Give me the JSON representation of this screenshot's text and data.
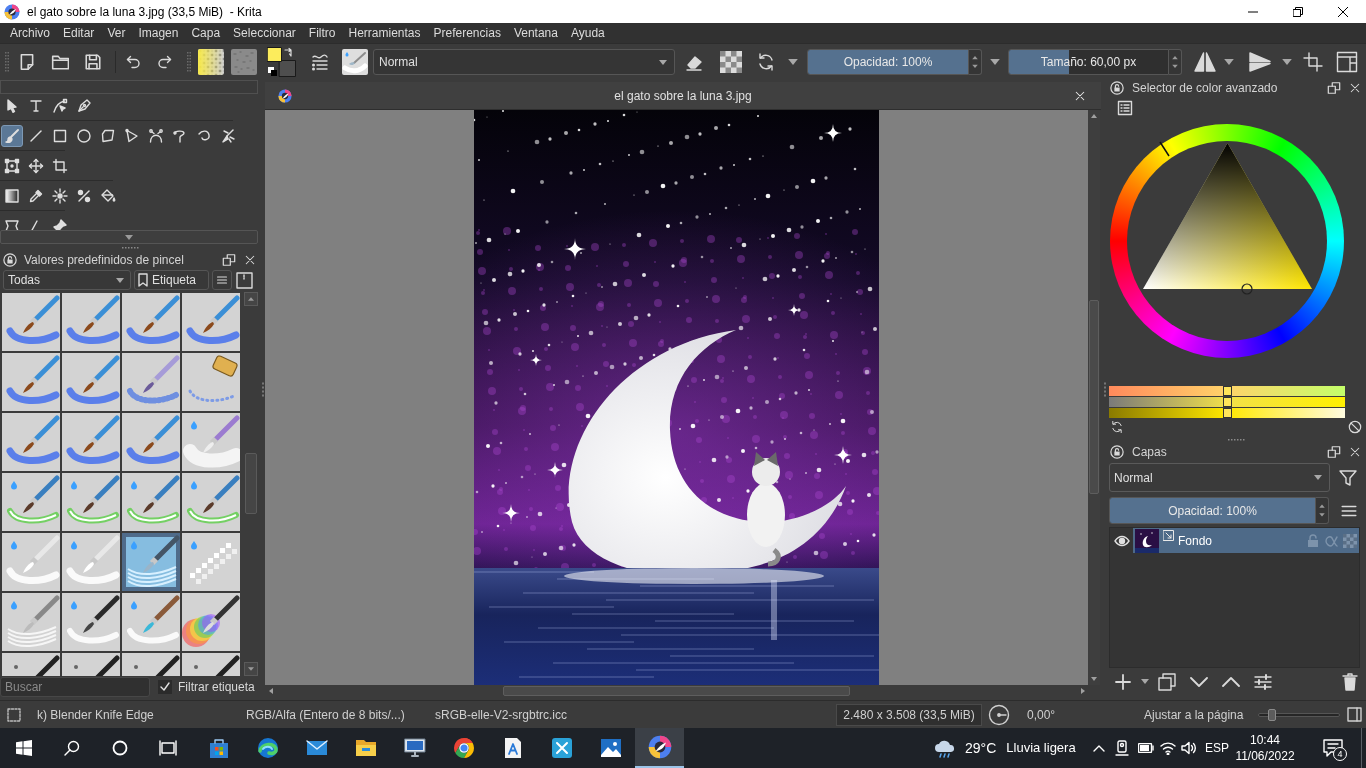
{
  "window": {
    "title": "el gato sobre la luna 3.jpg (33,5 MiB)  - Krita"
  },
  "menu": [
    "Archivo",
    "Editar",
    "Ver",
    "Imagen",
    "Capa",
    "Seleccionar",
    "Filtro",
    "Herramientas",
    "Preferencias",
    "Ventana",
    "Ayuda"
  ],
  "toolbar": {
    "blend_mode": "Normal",
    "opacity": {
      "label": "Opacidad: 100%",
      "level": 1
    },
    "size": {
      "label": "Tamaño: 60,00 px",
      "level": 0.38
    }
  },
  "toolbox": {
    "rows": [
      [
        {
          "selected": false
        },
        {
          "selected": false
        },
        {
          "selected": false
        },
        {
          "selected": false
        }
      ],
      [
        {
          "selected": true
        },
        {
          "selected": false
        },
        {
          "selected": false
        },
        {
          "selected": false
        },
        {
          "selected": false
        },
        {
          "selected": false
        },
        {
          "selected": false
        },
        {
          "selected": false
        },
        {
          "selected": false
        },
        {
          "selected": false
        }
      ],
      [
        {
          "selected": false
        },
        {
          "selected": false
        },
        {
          "selected": false
        }
      ],
      [
        {
          "selected": false
        },
        {
          "selected": false
        },
        {
          "selected": false
        },
        {
          "selected": false
        },
        {
          "selected": false
        }
      ],
      [
        {
          "selected": false
        },
        {
          "selected": false
        },
        {
          "selected": false
        }
      ]
    ]
  },
  "brush_presets": {
    "title": "Valores predefinidos de pincel",
    "category": "Todas",
    "tag_button": "Etiqueta",
    "presets": [
      {
        "selected": false
      },
      {
        "selected": false
      },
      {
        "selected": false
      },
      {
        "selected": false
      },
      {
        "selected": false
      },
      {
        "selected": false
      },
      {
        "selected": false
      },
      {
        "selected": false
      },
      {
        "selected": false
      },
      {
        "selected": false
      },
      {
        "selected": false
      },
      {
        "selected": false
      },
      {
        "selected": false
      },
      {
        "selected": false
      },
      {
        "selected": false
      },
      {
        "selected": false
      },
      {
        "selected": false
      },
      {
        "selected": false
      },
      {
        "selected": true
      },
      {
        "selected": false
      },
      {
        "selected": false
      },
      {
        "selected": false
      },
      {
        "selected": false
      },
      {
        "selected": false
      },
      {
        "selected": false
      },
      {
        "selected": false
      },
      {
        "selected": false
      },
      {
        "selected": false
      }
    ],
    "search": {
      "placeholder": "Buscar"
    },
    "filter_tag": {
      "label": "Filtrar etiqueta",
      "checked": true
    }
  },
  "document": {
    "tab_title": "el gato sobre la luna 3.jpg"
  },
  "color_selector": {
    "title": "Selector de color avanzado",
    "sliders": [
      {
        "level": 0.5
      },
      {
        "level": 0.5
      },
      {
        "level": 0.5
      }
    ]
  },
  "layers": {
    "title": "Capas",
    "blend_mode": "Normal",
    "opacity": {
      "label": "Opacidad: 100%",
      "level": 1
    },
    "items": [
      {
        "name": "Fondo",
        "visible": true,
        "selected": true
      }
    ]
  },
  "status_bar": {
    "brush": "k) Blender Knife Edge",
    "color_model": "RGB/Alfa (Entero de 8 bits/...)",
    "profile": "sRGB-elle-V2-srgbtrc.icc",
    "dimensions": "2.480 x 3.508 (33,5 MiB)",
    "rotation": "0,00°",
    "zoom_mode": "Ajustar a la página",
    "zoom": {
      "level": 0.17
    }
  },
  "taskbar": {
    "apps": [
      {
        "selected": false
      },
      {
        "selected": false
      },
      {
        "selected": false
      },
      {
        "selected": false
      },
      {
        "selected": false
      },
      {
        "selected": false
      },
      {
        "selected": false
      },
      {
        "selected": false
      },
      {
        "selected": false
      },
      {
        "selected": true
      }
    ],
    "weather": {
      "temperature": "29°C",
      "condition": "Lluvia ligera"
    },
    "language": "ESP",
    "time": "10:44",
    "date": "11/06/2022",
    "notifications": "4"
  }
}
